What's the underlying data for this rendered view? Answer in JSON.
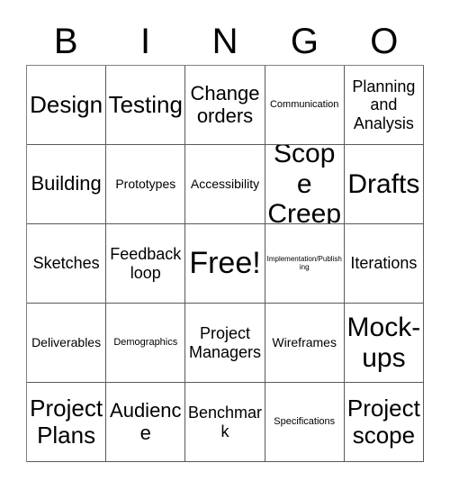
{
  "card": {
    "title_letters": [
      "B",
      "I",
      "N",
      "G",
      "O"
    ],
    "columns": 5,
    "rows": 5,
    "border_color": "#595959",
    "text_color": "#000000",
    "background_color": "#ffffff",
    "free_space_label": "Free!",
    "free_space_index": 12
  },
  "cells": [
    {
      "text": "Design",
      "size": "fs-2xl"
    },
    {
      "text": "Testing",
      "size": "fs-2xl"
    },
    {
      "text": "Change orders",
      "size": "fs-xl"
    },
    {
      "text": "Communication",
      "size": "fs-sm"
    },
    {
      "text": "Planning and Analysis",
      "size": "fs-lg"
    },
    {
      "text": "Building",
      "size": "fs-xl"
    },
    {
      "text": "Prototypes",
      "size": "fs-md"
    },
    {
      "text": "Accessibility",
      "size": "fs-md"
    },
    {
      "text": "Scope Creep",
      "size": "fs-3xl"
    },
    {
      "text": "Drafts",
      "size": "fs-3xl"
    },
    {
      "text": "Sketches",
      "size": "fs-lg"
    },
    {
      "text": "Feedback loop",
      "size": "fs-lg"
    },
    {
      "text": "Free!",
      "size": "fs-4xl"
    },
    {
      "text": "Implementation/Publishing",
      "size": "fs-xs"
    },
    {
      "text": "Iterations",
      "size": "fs-lg"
    },
    {
      "text": "Deliverables",
      "size": "fs-md"
    },
    {
      "text": "Demographics",
      "size": "fs-sm"
    },
    {
      "text": "Project Managers",
      "size": "fs-lg"
    },
    {
      "text": "Wireframes",
      "size": "fs-md"
    },
    {
      "text": "Mock-ups",
      "size": "fs-3xl"
    },
    {
      "text": "Project Plans",
      "size": "fs-2xl"
    },
    {
      "text": "Audience",
      "size": "fs-xl"
    },
    {
      "text": "Benchmark",
      "size": "fs-lg"
    },
    {
      "text": "Specifications",
      "size": "fs-sm"
    },
    {
      "text": "Project scope",
      "size": "fs-2xl"
    }
  ]
}
